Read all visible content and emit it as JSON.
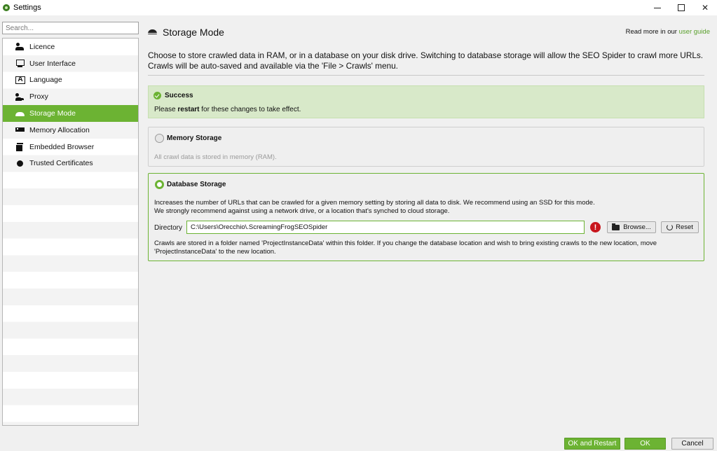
{
  "window": {
    "title": "Settings",
    "app_icon": "frog-icon",
    "controls": {
      "minimize": "minimize",
      "maximize": "maximize",
      "close": "✕"
    }
  },
  "search": {
    "placeholder": "Search...",
    "value": ""
  },
  "sidebar": {
    "items": [
      {
        "label": "Licence",
        "icon": "licence-icon",
        "active": false
      },
      {
        "label": "User Interface",
        "icon": "monitor-icon",
        "active": false
      },
      {
        "label": "Language",
        "icon": "language-icon",
        "active": false
      },
      {
        "label": "Proxy",
        "icon": "proxy-icon",
        "active": false
      },
      {
        "label": "Storage Mode",
        "icon": "storage-icon",
        "active": true
      },
      {
        "label": "Memory Allocation",
        "icon": "memory-icon",
        "active": false
      },
      {
        "label": "Embedded Browser",
        "icon": "browser-icon",
        "active": false
      },
      {
        "label": "Trusted Certificates",
        "icon": "certificate-icon",
        "active": false
      }
    ]
  },
  "main": {
    "title": "Storage Mode",
    "read_more_prefix": "Read more in our ",
    "read_more_link": "user guide",
    "intro": "Choose to store crawled data in RAM, or in a database on your disk drive. Switching to database storage will allow the SEO Spider to crawl more URLs. Crawls will be auto-saved and available via the 'File > Crawls' menu.",
    "success": {
      "title": "Success",
      "message_prefix": "Please ",
      "message_bold": "restart",
      "message_suffix": " for these changes to take effect."
    },
    "memory_storage": {
      "label": "Memory Storage",
      "description": "All crawl data is stored in memory (RAM).",
      "selected": false
    },
    "database_storage": {
      "label": "Database Storage",
      "selected": true,
      "description_1": "Increases the number of URLs that can be crawled for a given memory setting by storing all data to disk. We recommend using an SSD for this mode.",
      "description_2": "We strongly recommend against using a network drive, or a location that's synched to cloud storage.",
      "directory_label": "Directory",
      "directory_value": "C:\\Users\\Orecchio\\.ScreamingFrogSEOSpider",
      "error_glyph": "!",
      "browse_label": "Browse...",
      "reset_label": "Reset",
      "note": "Crawls are stored in a folder named 'ProjectInstanceData' within this folder. If you change the database location and wish to bring existing crawls to the new location, move 'ProjectInstanceData' to the new location."
    }
  },
  "footer": {
    "ok_restart": "OK and Restart",
    "ok": "OK",
    "cancel": "Cancel"
  },
  "colors": {
    "accent": "#6cb333",
    "success_bg": "#d8e9c9",
    "error": "#c8161d",
    "link": "#5aa02c"
  }
}
